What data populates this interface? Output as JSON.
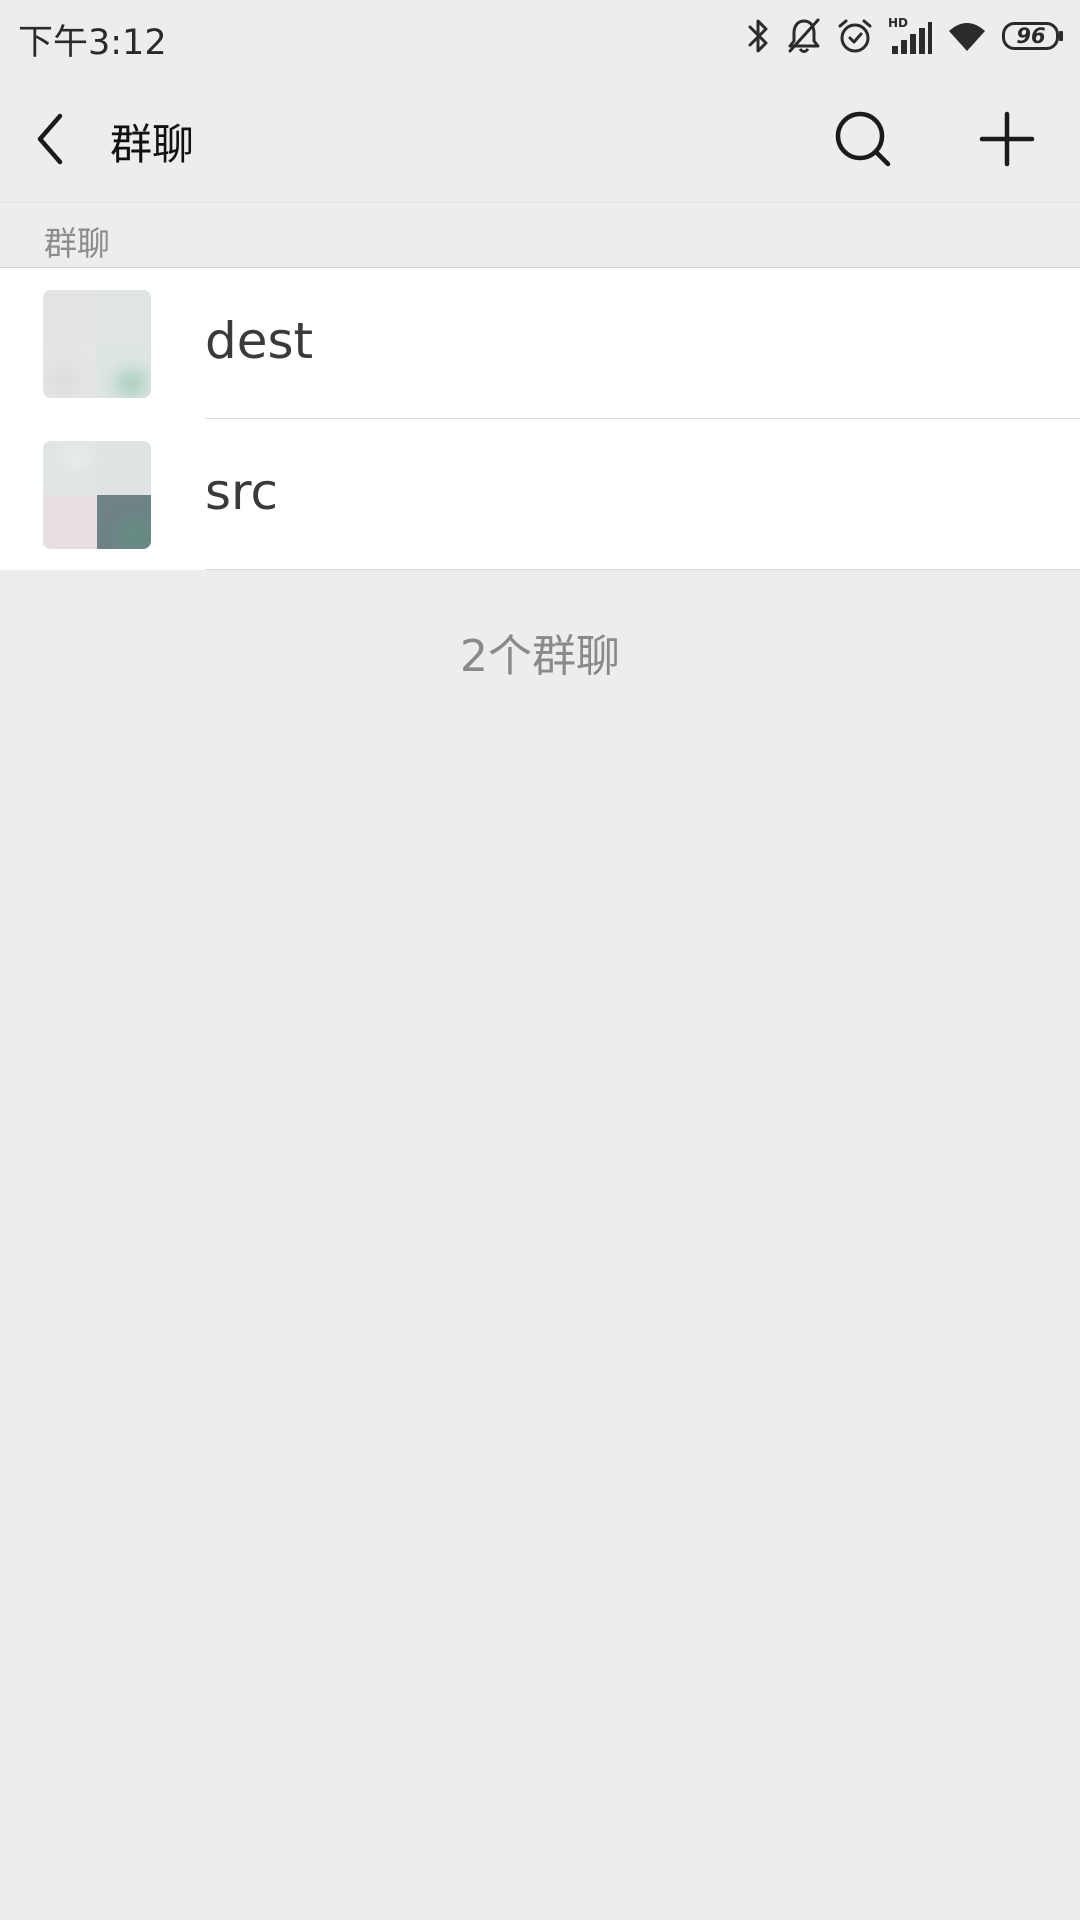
{
  "status_bar": {
    "time": "下午3:12",
    "battery_level": "96",
    "icons": [
      "bluetooth-icon",
      "bell-muted-icon",
      "alarm-icon",
      "cellular-signal-icon",
      "wifi-icon",
      "battery-icon"
    ],
    "network_badge": "HD"
  },
  "header": {
    "back_icon": "chevron-left-icon",
    "title": "群聊",
    "search_icon": "search-icon",
    "add_icon": "plus-icon"
  },
  "section": {
    "label": "群聊"
  },
  "groups": [
    {
      "name": "dest"
    },
    {
      "name": "src"
    }
  ],
  "footer": {
    "count_text": "2个群聊"
  },
  "colors": {
    "background": "#ededed",
    "list_background": "#ffffff",
    "secondary_text": "#8c8c8c",
    "divider": "#dcdcdc"
  }
}
